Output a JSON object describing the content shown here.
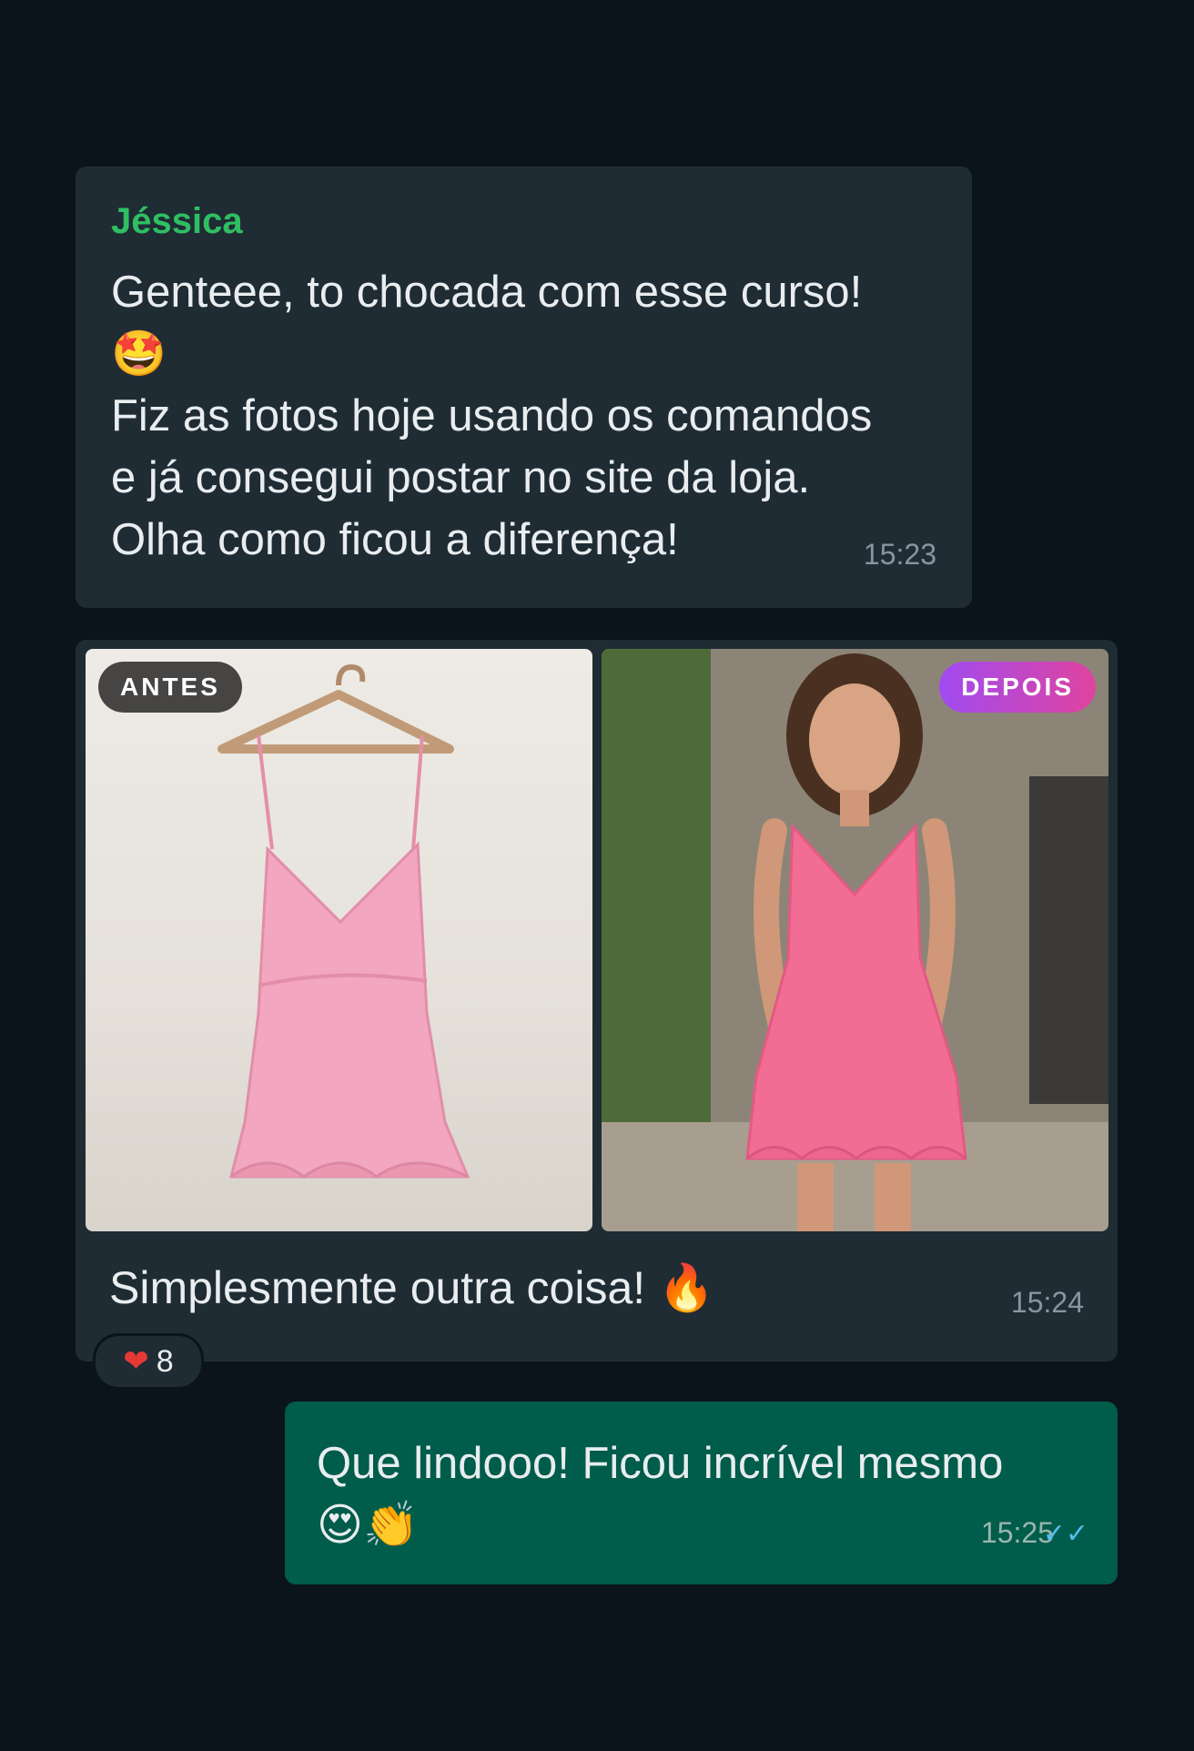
{
  "messages": [
    {
      "sender": "Jéssica",
      "line1": "Genteee, to chocada com esse curso!",
      "emoji1": "🤩",
      "line2": "Fiz as fotos hoje usando os comandos",
      "line3": "e já consegui postar no site da loja.",
      "line4": "Olha como ficou a diferença!",
      "time": "15:23"
    },
    {
      "tag_before": "ANTES",
      "tag_after": "DEPOIS",
      "caption": "Simplesmente outra coisa! 🔥",
      "time": "15:24",
      "reaction_emoji": "❤",
      "reaction_count": "8"
    },
    {
      "text": "Que lindooo! Ficou incrível mesmo",
      "emoji": "😍👏",
      "time": "15:25",
      "ticks": "✓✓"
    }
  ],
  "colors": {
    "background": "#0b131b",
    "incoming_bubble": "#1f2c34",
    "outgoing_bubble": "#005c4b",
    "sender_name": "#2fbf62",
    "read_ticks": "#53bdeb"
  }
}
